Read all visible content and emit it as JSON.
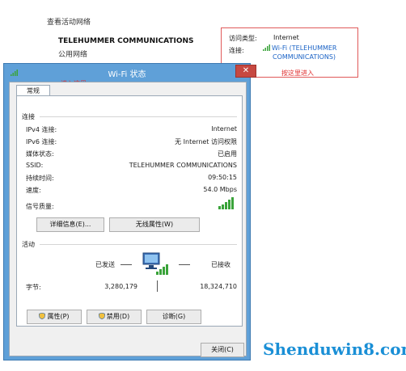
{
  "background": {
    "section_title": "查看活动网络",
    "network_name": "TELEHUMMER COMMUNICATIONS",
    "network_type": "公用网络",
    "access_type_label": "访问类型:",
    "access_type_value": "Internet",
    "connection_label": "连接:",
    "connection_link_line1": "Wi-Fi (TELEHUMMER",
    "connection_link_line2": "COMMUNICATIONS)",
    "annotation_click_here": "按这里进入"
  },
  "dialog": {
    "title": "Wi-Fi 状态",
    "close_glyph": "✕",
    "annotation_enter_here": "进入这里",
    "tab_general": "常规",
    "connection_group": "连接",
    "rows": [
      {
        "label": "IPv4 连接:",
        "value": "Internet"
      },
      {
        "label": "IPv6 连接:",
        "value": "无 Internet 访问权限"
      },
      {
        "label": "媒体状态:",
        "value": "已启用"
      },
      {
        "label": "SSID:",
        "value": "TELEHUMMER COMMUNICATIONS"
      },
      {
        "label": "持续时间:",
        "value": "09:50:15"
      },
      {
        "label": "速度:",
        "value": "54.0 Mbps"
      }
    ],
    "signal_label": "信号质量:",
    "details_button": "详细信息(E)...",
    "wireless_props_button": "无线属性(W)",
    "activity_group": "活动",
    "sent_label": "已发送",
    "received_label": "已接收",
    "bytes_label": "字节:",
    "bytes_sent": "3,280,179",
    "bytes_received": "18,324,710",
    "properties_button": "属性(P)",
    "disable_button": "禁用(D)",
    "diagnose_button": "诊断(G)",
    "close_button": "关闭(C)"
  },
  "watermark": "Shenduwin8.com",
  "colors": {
    "title_bar": "#5fa0d8",
    "close_red": "#c64841",
    "signal_green": "#3aa33a",
    "link_blue": "#1b63c6",
    "annotation_red": "#e03030"
  },
  "icons": [
    "signal-bars-icon",
    "network-computer-icon",
    "shield-icon"
  ]
}
